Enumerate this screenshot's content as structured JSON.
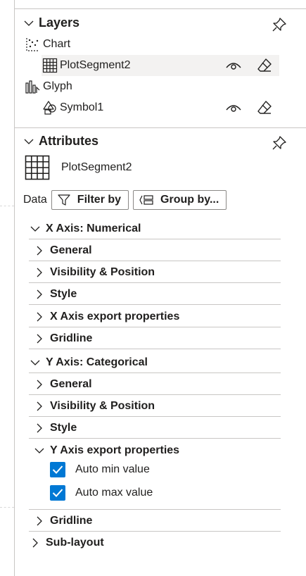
{
  "layers": {
    "title": "Layers",
    "items": [
      {
        "label": "Chart"
      },
      {
        "label": "PlotSegment2"
      },
      {
        "label": "Glyph"
      },
      {
        "label": "Symbol1"
      }
    ]
  },
  "attributes": {
    "title": "Attributes",
    "object_name": "PlotSegment2",
    "data_label": "Data",
    "filter_label": "Filter by",
    "group_label": "Group by...",
    "x_axis": {
      "title": "X Axis: Numerical",
      "items": [
        "General",
        "Visibility & Position",
        "Style",
        "X Axis export properties",
        "Gridline"
      ]
    },
    "y_axis": {
      "title": "Y Axis: Categorical",
      "items": [
        "General",
        "Visibility & Position",
        "Style"
      ],
      "export_title": "Y Axis export properties",
      "auto_min": "Auto min value",
      "auto_max": "Auto max value",
      "gridline": "Gridline"
    },
    "sublayout": "Sub-layout"
  },
  "colors": {
    "accent": "#0078d4",
    "selected_bg": "#f3f2f1",
    "border": "#c8c6c4"
  }
}
